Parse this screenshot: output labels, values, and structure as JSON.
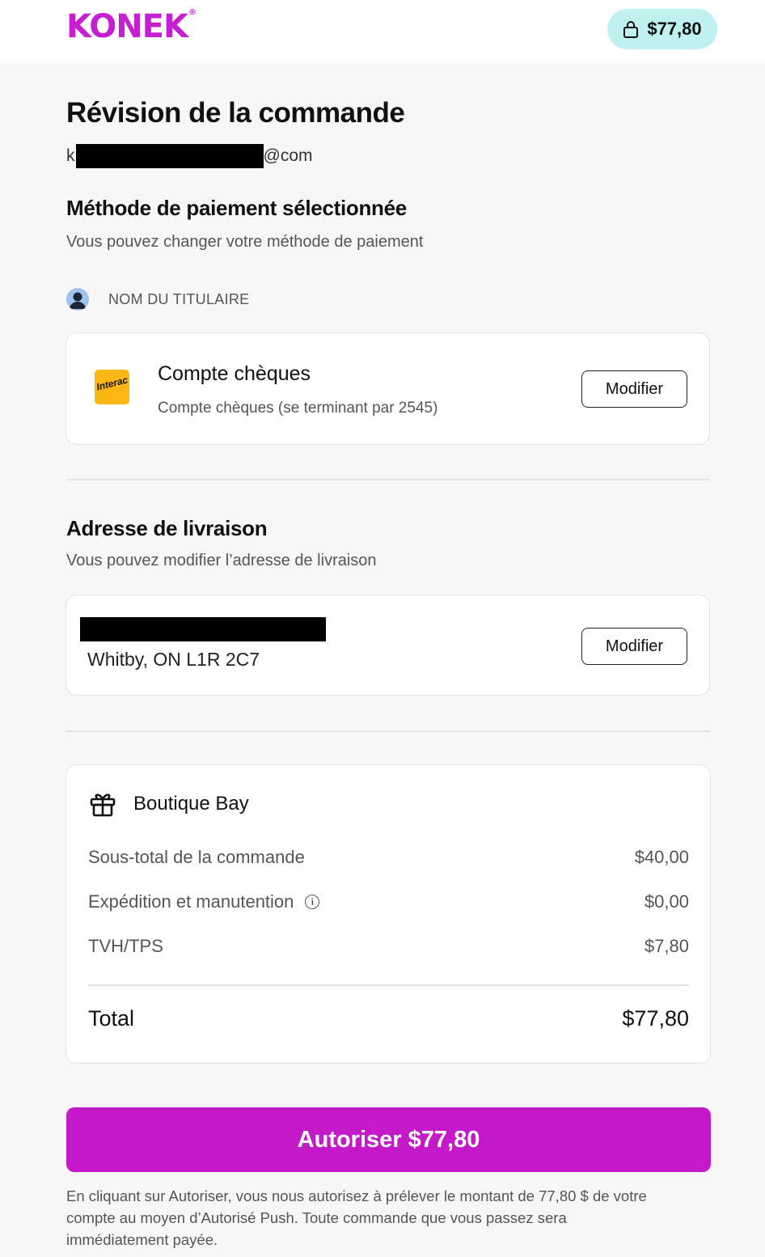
{
  "header": {
    "logo_text": "KONEK",
    "logo_mark": "®",
    "cart_amount": "$77,80",
    "cart_icon": "lock-icon"
  },
  "review": {
    "title": "Révision de la commande",
    "email_prefix": "k",
    "email_suffix": "@com"
  },
  "payment": {
    "title": "Méthode de paiement sélectionnée",
    "subtitle": "Vous pouvez changer votre méthode de paiement",
    "holder_label": "NOM DU TITULAIRE",
    "brand_label": "Interac",
    "account_name": "Compte chèques",
    "account_detail": "Compte chèques (se terminant par 2545)",
    "modify_label": "Modifier"
  },
  "shipping": {
    "title": "Adresse de livraison",
    "subtitle": "Vous pouvez modifier l’adresse de livraison",
    "city_line": "Whitby, ON  L1R 2C7",
    "modify_label": "Modifier"
  },
  "summary": {
    "store_name": "Boutique Bay",
    "store_icon": "gift-icon",
    "items": [
      {
        "label": "Sous-total de la commande",
        "value": "$40,00"
      },
      {
        "label": "Expédition et manutention",
        "value": "$0,00"
      },
      {
        "label": "TVH/TPS",
        "value": "$7,80"
      }
    ],
    "info_glyph": "i",
    "total_label": "Total",
    "total_value": "$77,80"
  },
  "authorize_label": "Autoriser $77,80",
  "legal_text": "En cliquant sur Autoriser, vous nous autorisez à prélever le montant de 77,80 $ de votre compte au moyen d’Autorisé Push. Toute commande que vous passez sera immédiatement payée.",
  "colors": {
    "brand": "#c41fd0",
    "button": "#c419c9",
    "cart_pill": "#bff1f1",
    "interac": "#fdb714"
  }
}
